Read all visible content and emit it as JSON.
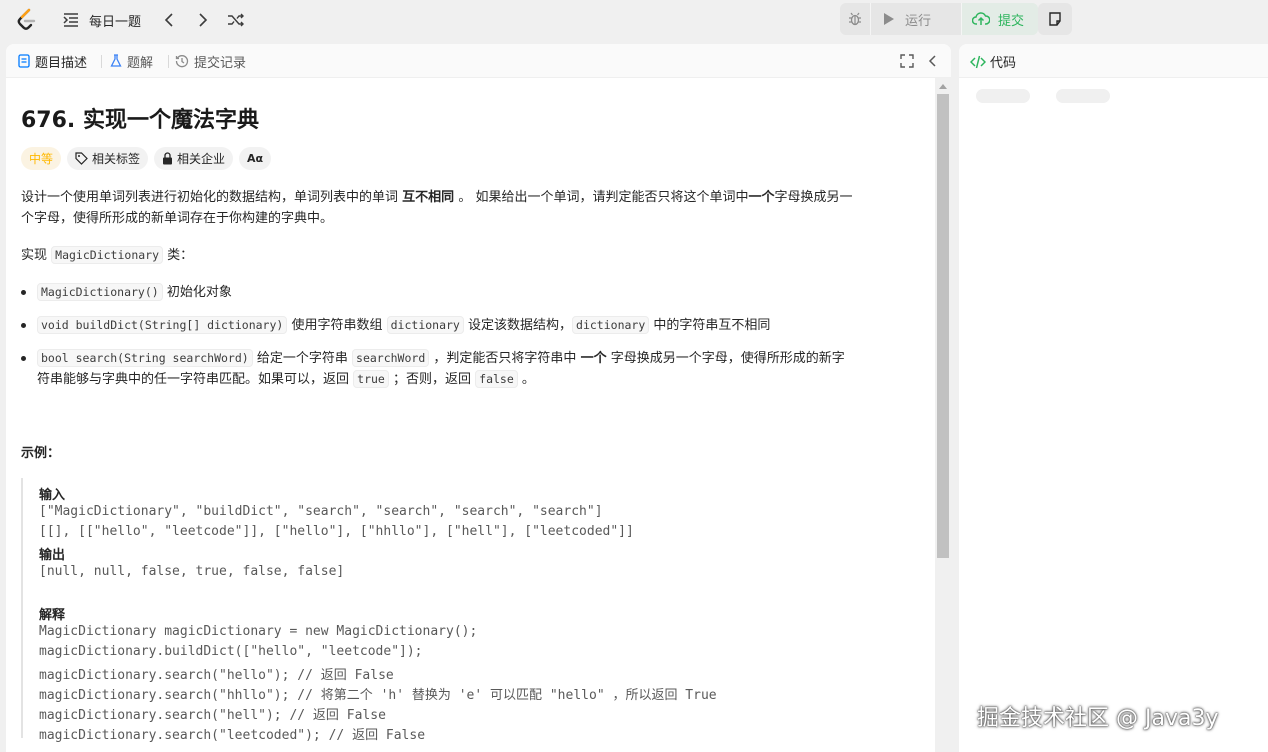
{
  "topbar": {
    "daily_label": "每日一题",
    "run_label": "运行",
    "submit_label": "提交"
  },
  "tabs": {
    "description": "题目描述",
    "solution": "题解",
    "submissions": "提交记录"
  },
  "code_panel": {
    "title": "代码"
  },
  "problem": {
    "title": "676. 实现一个魔法字典",
    "difficulty": "中等",
    "tags_label": "相关标签",
    "companies_label": "相关企业",
    "font_label": "Aα",
    "desc_line1_a": "设计一个使用单词列表进行初始化的数据结构，单词列表中的单词",
    "desc_line1_bold": "互不相同",
    "desc_line1_b": "。 如果给出一个单词，请判定能否只将这个单词中",
    "desc_line1_bold2": "一个",
    "desc_line1_c": "字母换成另一",
    "desc_line2": "个字母，使得所形成的新单词存在于你构建的字典中。",
    "impl_prefix": "实现",
    "impl_code": "MagicDictionary",
    "impl_suffix": "类：",
    "b1_code": "MagicDictionary()",
    "b1_text": "初始化对象",
    "b2_code": "void buildDict(String[] dictionary)",
    "b2_text_a": "使用字符串数组",
    "b2_code2": "dictionary",
    "b2_text_b": "设定该数据结构，",
    "b2_code3": "dictionary",
    "b2_text_c": "中的字符串互不相同",
    "b3_code": "bool search(String searchWord)",
    "b3_text_a": "给定一个字符串",
    "b3_code2": "searchWord",
    "b3_text_b": "，判定能否只将字符串中",
    "b3_bold": "一个",
    "b3_text_c": "字母换成另一个字母，使得所形成的新字",
    "b3_line2_a": "符串能够与字典中的任一字符串匹配。如果可以，返回",
    "b3_code3": "true",
    "b3_line2_b": "；否则，返回",
    "b3_code4": "false",
    "b3_line2_c": "。",
    "example_heading": "示例："
  },
  "example": {
    "input_label": "输入",
    "input_line1": "[\"MagicDictionary\", \"buildDict\", \"search\", \"search\", \"search\", \"search\"]",
    "input_line2": "[[], [[\"hello\", \"leetcode\"]], [\"hello\"], [\"hhllo\"], [\"hell\"], [\"leetcoded\"]]",
    "output_label": "输出",
    "output_line": "[null, null, false, true, false, false]",
    "explain_label": "解释",
    "explain_lines": [
      "MagicDictionary magicDictionary = new MagicDictionary();",
      "magicDictionary.buildDict([\"hello\", \"leetcode\"]);",
      "magicDictionary.search(\"hello\"); // 返回 False",
      "magicDictionary.search(\"hhllo\"); // 将第二个 'h' 替换为 'e' 可以匹配 \"hello\" ，所以返回 True",
      "magicDictionary.search(\"hell\"); // 返回 False",
      "magicDictionary.search(\"leetcoded\"); // 返回 False"
    ]
  },
  "watermark": "掘金技术社区 @ Java3y",
  "colors": {
    "accent_green": "#2db55d",
    "difficulty_yellow": "#ffb800",
    "background": "#f0f0f0"
  }
}
